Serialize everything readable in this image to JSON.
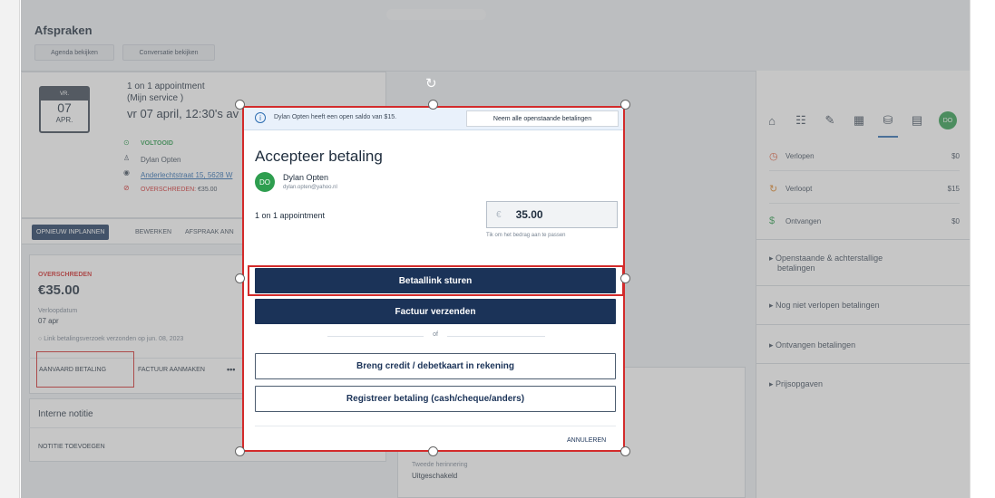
{
  "page": {
    "title": "Afspraken",
    "btn_agenda": "Agenda bekijken",
    "btn_conversatie": "Conversatie bekijken"
  },
  "appointment": {
    "cal_weekday": "VR.",
    "cal_day": "07",
    "cal_month": "APR.",
    "name": "1 on 1 appointment",
    "service": "(Mijn service )",
    "datetime": "vr 07 april, 12:30's av",
    "status": "VOLTOOID",
    "contact": "Dylan Opten",
    "address": "Anderlechtstraat 15, 5628 W",
    "overdue_label": "OVERSCHREDEN:",
    "overdue_amount": "€35.00"
  },
  "tabs": {
    "reschedule": "OPNIEUW INPLANNEN",
    "edit": "BEWERKEN",
    "cancel": "AFSPRAAK ANN"
  },
  "invoice_card": {
    "status": "OVERSCHREDEN",
    "amount": "€35.00",
    "due_label": "Verloopdatum",
    "due_date": "07 apr",
    "link_note": "Link betalingsverzoek verzonden op jun. 08, 2023",
    "accept_btn": "AANVAARD BETALING",
    "invoice_btn": "FACTUUR AANMAKEN",
    "more": "•••"
  },
  "notes": {
    "title": "Interne notitie",
    "add": "NOTITIE TOEVOEGEN"
  },
  "reminder": {
    "label": "Tweede herinnering",
    "value": "Uitgeschakeld"
  },
  "right_panel": {
    "avatar": "DO",
    "rows": [
      {
        "label": "Verlopen",
        "value": "$0",
        "color": "#e0522f"
      },
      {
        "label": "Verloopt",
        "value": "$15",
        "color": "#e08a2f"
      },
      {
        "label": "Ontvangen",
        "value": "$0",
        "color": "#2e9e4f"
      }
    ],
    "sections": [
      {
        "label": "Openstaande & achterstallige",
        "label2": "betalingen"
      },
      {
        "label": "Nog niet verlopen betalingen"
      },
      {
        "label": "Ontvangen betalingen"
      },
      {
        "label": "Prijsopgaven"
      }
    ]
  },
  "modal": {
    "info_text": "Dylan Opten heeft een open saldo van $15.",
    "info_btn": "Neem alle openstaande betalingen",
    "title": "Accepteer betaling",
    "avatar": "DO",
    "contact_name": "Dylan Opten",
    "contact_email": "dylan.opten@yahoo.nl",
    "line_item": "1 on 1 appointment",
    "currency": "€",
    "amount": "35.00",
    "amount_hint": "Tik om het bedrag aan te passen",
    "btn_paylink": "Betaallink sturen",
    "btn_invoice": "Factuur verzenden",
    "divider": "of",
    "btn_card": "Breng credit / debetkaart in rekening",
    "btn_register": "Registreer betaling (cash/cheque/anders)",
    "cancel": "ANNULEREN"
  }
}
